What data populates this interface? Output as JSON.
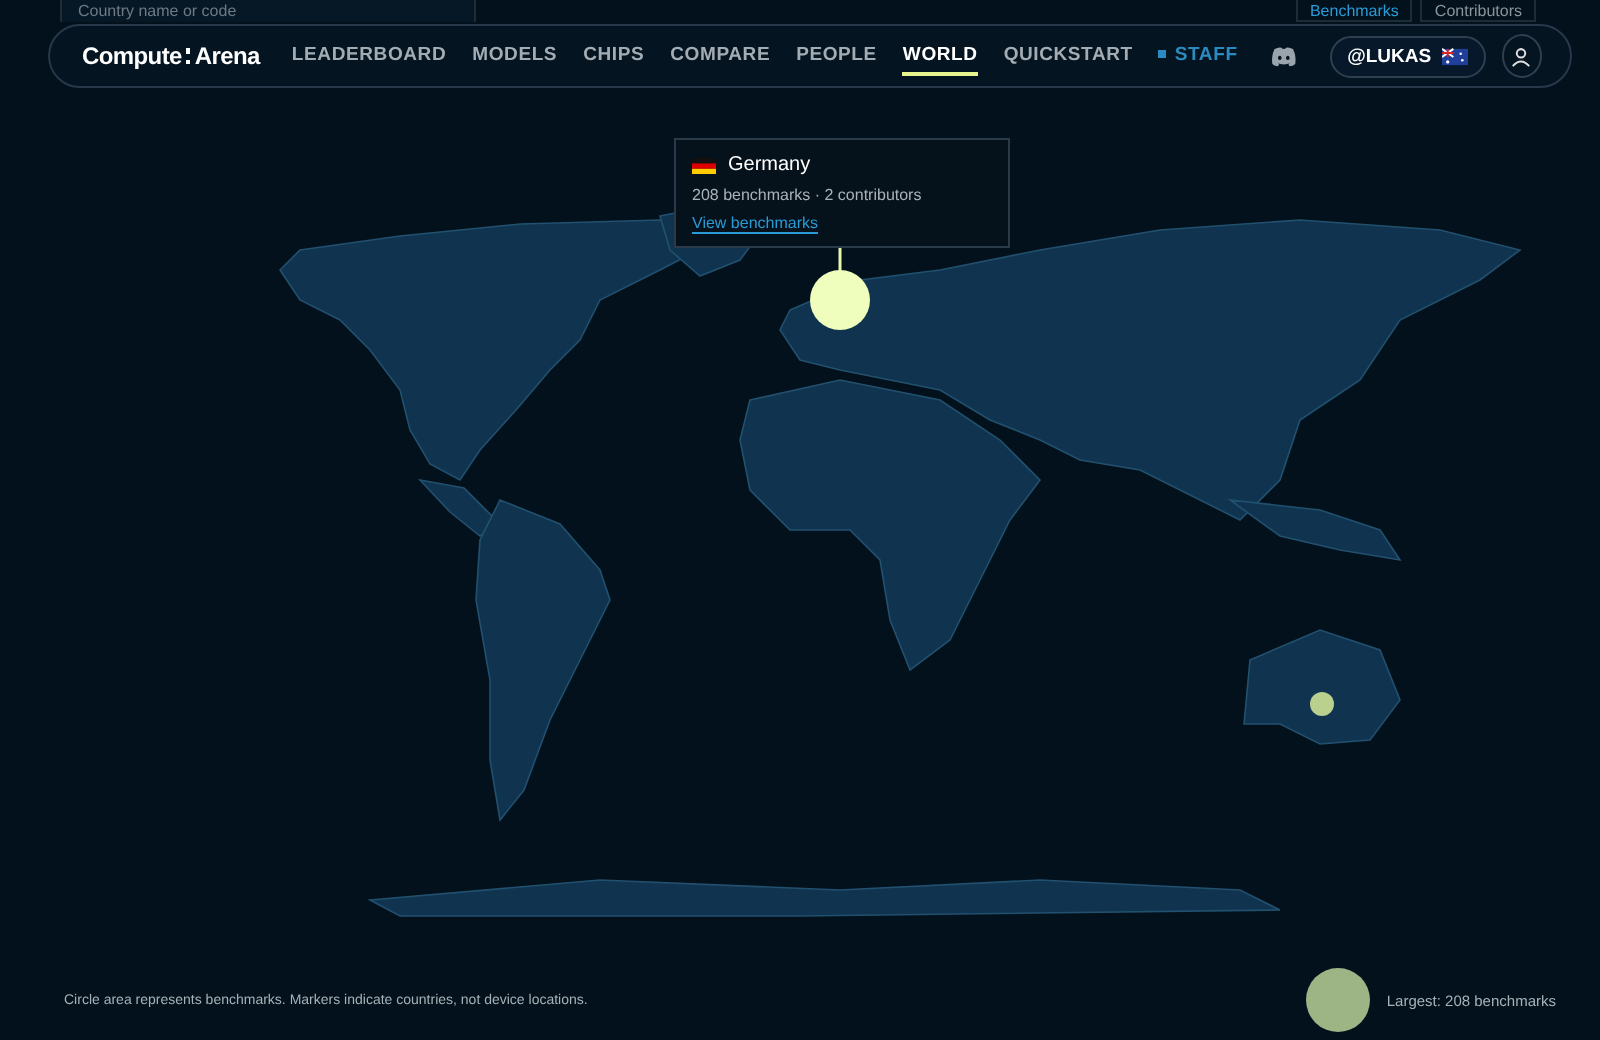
{
  "filter_bar": {
    "search": {
      "placeholder": "Country name or code"
    },
    "toggles": [
      {
        "label": "Benchmarks",
        "selected": true
      },
      {
        "label": "Contributors",
        "selected": false
      }
    ]
  },
  "nav": {
    "logo": {
      "left": "Compute",
      "right": "Arena"
    },
    "links": [
      {
        "label": "LEADERBOARD",
        "selected": false,
        "kind": "link"
      },
      {
        "label": "MODELS",
        "selected": false,
        "kind": "link"
      },
      {
        "label": "CHIPS",
        "selected": false,
        "kind": "link"
      },
      {
        "label": "COMPARE",
        "selected": false,
        "kind": "link"
      },
      {
        "label": "PEOPLE",
        "selected": false,
        "kind": "link"
      },
      {
        "label": "WORLD",
        "selected": true,
        "kind": "link"
      },
      {
        "label": "QUICKSTART",
        "selected": false,
        "kind": "link"
      },
      {
        "label": "STAFF",
        "selected": false,
        "kind": "staff"
      }
    ],
    "user": "@LUKAS"
  },
  "tooltip": {
    "country": "Germany",
    "stats": "208 benchmarks · 2 contributors",
    "link": "View benchmarks"
  },
  "footer": {
    "note": "Circle area represents benchmarks. Markers indicate countries, not device locations.",
    "legend": "Largest: 208 benchmarks"
  }
}
